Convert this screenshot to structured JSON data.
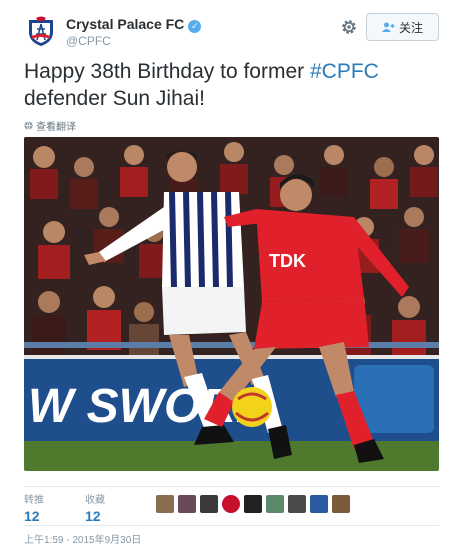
{
  "account": {
    "name": "Crystal Palace FC",
    "handle": "@CPFC",
    "verified_icon": "verified-badge-icon",
    "avatar_icon": "crystal-palace-crest"
  },
  "actions": {
    "settings_icon": "gear-icon",
    "follow_label": "关注",
    "follow_icon": "add-user-icon"
  },
  "tweet": {
    "text_prefix": "Happy 38th Birthday to former ",
    "hashtag": "#CPFC",
    "text_suffix": " defender Sun Jihai!",
    "translate_label": "查看翻译"
  },
  "media": {
    "type": "football-match-photo",
    "hoarding_text": "W SWORD",
    "shirt_sponsor": "TDK"
  },
  "stats": {
    "retweets_label": "转推",
    "retweets_count": "12",
    "likes_label": "收藏",
    "likes_count": "12",
    "liker_avatar_count": "9"
  },
  "timestamp": "上午1:59 - 2015年9月30日",
  "colors": {
    "link": "#2b7bb9",
    "muted": "#8899a6",
    "text": "#292f33",
    "verified": "#55acee",
    "palace_red": "#e0202a"
  }
}
